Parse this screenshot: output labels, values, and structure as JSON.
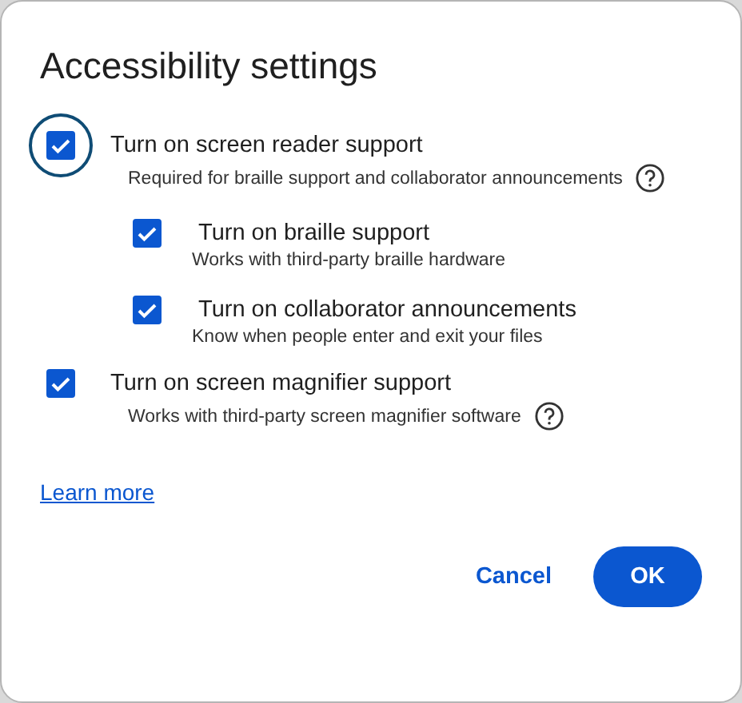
{
  "title": "Accessibility settings",
  "options": [
    {
      "label": "Turn on screen reader support",
      "description": "Required for braille support and collaborator announcements",
      "checked": true,
      "focused": true,
      "help": true,
      "children": [
        {
          "label": "Turn on braille support",
          "description": "Works with third-party braille hardware",
          "checked": true,
          "focused": false,
          "help": false
        },
        {
          "label": "Turn on collaborator announcements",
          "description": "Know when people enter and exit your files",
          "checked": true,
          "focused": false,
          "help": false
        }
      ]
    },
    {
      "label": "Turn on screen magnifier support",
      "description": "Works with third-party screen magnifier software",
      "checked": true,
      "focused": false,
      "help": true
    }
  ],
  "link": "Learn more",
  "buttons": [
    {
      "label": "Cancel",
      "kind": "text"
    },
    {
      "label": "OK",
      "kind": "filled"
    }
  ]
}
